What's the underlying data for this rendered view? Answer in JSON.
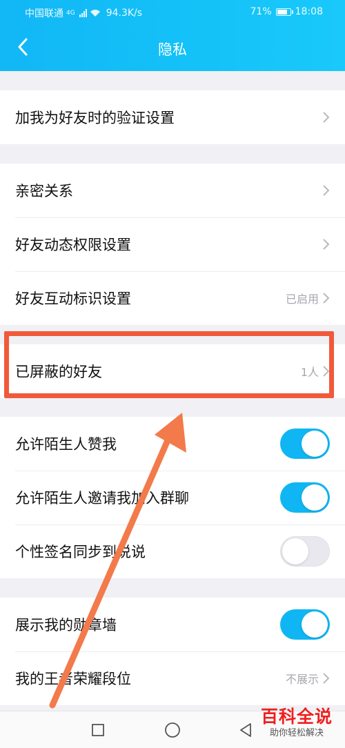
{
  "status_bar": {
    "carrier": "中国联通",
    "network": "4G",
    "speed": "94.3K/s",
    "battery": "71%",
    "time": "18:08"
  },
  "header": {
    "title": "隐私",
    "back_icon": "chevron-left-icon"
  },
  "groups": [
    {
      "items": [
        {
          "label": "加我为好友时的验证设置",
          "value": "",
          "control": "chevron"
        }
      ]
    },
    {
      "items": [
        {
          "label": "亲密关系",
          "value": "",
          "control": "chevron"
        },
        {
          "label": "好友动态权限设置",
          "value": "",
          "control": "chevron"
        },
        {
          "label": "好友互动标识设置",
          "value": "已启用",
          "control": "chevron"
        }
      ]
    },
    {
      "items": [
        {
          "label": "已屏蔽的好友",
          "value": "1人",
          "control": "chevron"
        }
      ]
    },
    {
      "items": [
        {
          "label": "允许陌生人赞我",
          "control": "toggle",
          "on": true
        },
        {
          "label": "允许陌生人邀请我加入群聊",
          "control": "toggle",
          "on": true
        },
        {
          "label": "个性签名同步到说说",
          "control": "toggle",
          "on": false
        }
      ]
    },
    {
      "items": [
        {
          "label": "展示我的勋章墙",
          "control": "toggle",
          "on": true
        },
        {
          "label": "我的王者荣耀段位",
          "value": "不展示",
          "control": "chevron"
        }
      ]
    }
  ],
  "watermark": {
    "main": "百科全说",
    "sub": "助你轻松解决"
  },
  "colors": {
    "header_start": "#12b7f5",
    "toggle_on": "#10b6f3",
    "annotation": "#f05a3a",
    "watermark": "#f01f1f"
  }
}
